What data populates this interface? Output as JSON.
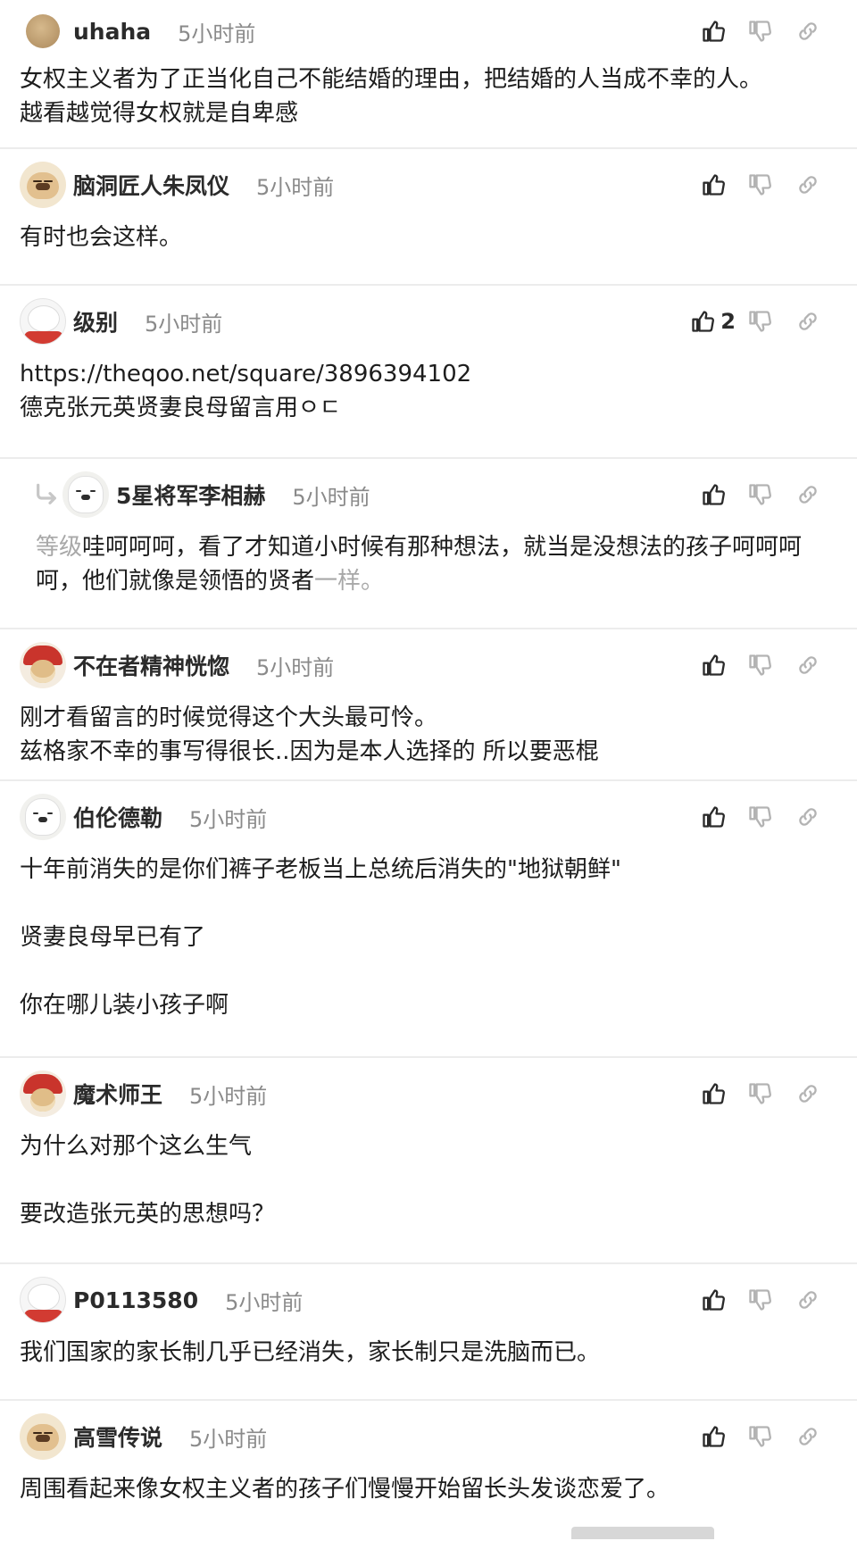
{
  "comments": [
    {
      "username": "uhaha",
      "time": "5小时前",
      "lines": [
        "女权主义者为了正当化自己不能结婚的理由，把结婚的人当成不幸的人。",
        "越看越觉得女权就是自卑感"
      ],
      "likes": "",
      "avatar": "tan-circle"
    },
    {
      "username": "脑洞匠人朱凤仪",
      "time": "5小时前",
      "lines": [
        "有时也会这样。"
      ],
      "likes": "",
      "avatar": "dog-icon"
    },
    {
      "username": "级别",
      "time": "5小时前",
      "lines": [
        "https://theqoo.net/square/3896394102",
        "德克张元英贤妻良母留言用ㅇㄷ"
      ],
      "likes": "2",
      "avatar": "bear-icon"
    },
    {
      "username": "5星将军李相赫",
      "time": "5小时前",
      "reply": true,
      "reply_prefix": "等级",
      "line1_rest": "哇呵呵呵，看了才知道小时候有那种想法，就当是没想法的孩子呵呵呵",
      "line2_main": "呵，他们就像是领悟的贤者",
      "reply_suffix": "一样。",
      "likes": "",
      "avatar": "samoyed-icon"
    },
    {
      "username": "不在者精神恍惚",
      "time": "5小时前",
      "lines": [
        "刚才看留言的时候觉得这个大头最可怜。",
        "兹格家不幸的事写得很长..因为是本人选择的 所以要恶棍"
      ],
      "likes": "",
      "avatar": "red-dog-icon"
    },
    {
      "username": "伯伦德勒",
      "time": "5小时前",
      "lines": [
        "十年前消失的是你们裤子老板当上总统后消失的\"地狱朝鲜\"",
        "",
        "贤妻良母早已有了",
        "",
        "你在哪儿装小孩子啊"
      ],
      "likes": "",
      "avatar": "samoyed-icon"
    },
    {
      "username": "魔术师王",
      "time": "5小时前",
      "lines": [
        "为什么对那个这么生气",
        "",
        "要改造张元英的思想吗？"
      ],
      "likes": "",
      "avatar": "red-dog-icon"
    },
    {
      "username": "P0113580",
      "time": "5小时前",
      "lines": [
        "我们国家的家长制几乎已经消失，家长制只是洗脑而已。"
      ],
      "likes": "",
      "avatar": "bear-icon"
    },
    {
      "username": "高雪传说",
      "time": "5小时前",
      "lines": [
        "周围看起来像女权主义者的孩子们慢慢开始留长头发谈恋爱了。"
      ],
      "likes": "",
      "avatar": "dog-icon"
    }
  ],
  "icons": {
    "like": "thumbs-up-icon",
    "dislike": "thumbs-down-icon",
    "share": "link-icon",
    "reply": "reply-arrow-icon"
  },
  "colors": {
    "text": "#1d1d1d",
    "meta": "#8a8a8a",
    "icon": "#2b2b2b",
    "icon_muted": "#b3b3b3",
    "divider": "#ececec"
  }
}
